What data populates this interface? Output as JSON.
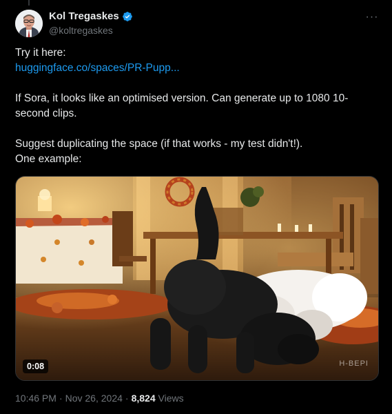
{
  "author": {
    "display_name": "Kol Tregaskes",
    "handle": "@koltregaskes",
    "verified": true,
    "avatar_icon": "user-avatar"
  },
  "tweet": {
    "line1": "Try it here:",
    "link_text": "huggingface.co/spaces/PR-Pupp...",
    "para2": "If Sora, it looks like an optimised version.  Can generate up to 1080 10-second clips.",
    "para3_line1": "Suggest duplicating the space (if that works - my test didn't!).",
    "para3_line2": "One example:"
  },
  "media": {
    "duration": "0:08",
    "watermark": "H-BEPI"
  },
  "meta": {
    "time": "10:46 PM",
    "date": "Nov 26, 2024",
    "separator": "·",
    "views_count": "8,824",
    "views_label": "Views"
  },
  "colors": {
    "background": "#000000",
    "text": "#e7e9ea",
    "muted": "#71767b",
    "link": "#1d9bf0",
    "verified": "#1d9bf0"
  }
}
